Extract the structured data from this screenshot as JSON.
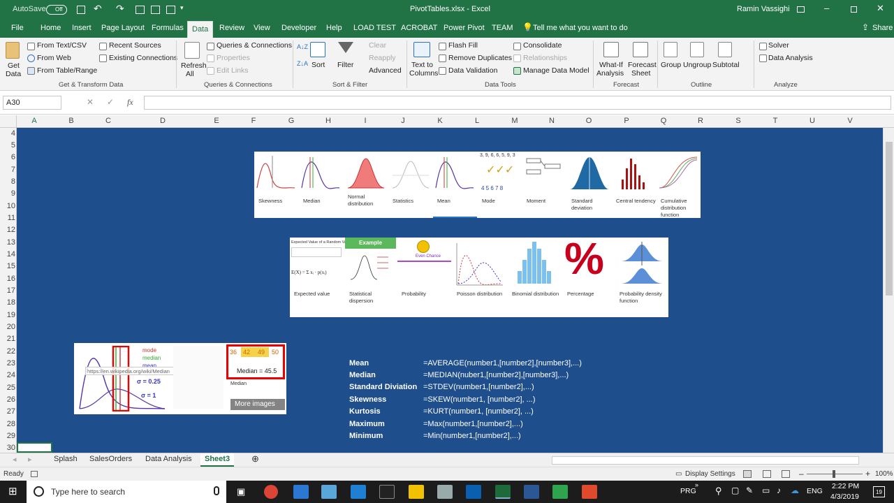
{
  "window": {
    "autosave_label": "AutoSave",
    "autosave_state": "Off",
    "title": "PivotTables.xlsx  -  Excel",
    "user": "Ramin Vassighi"
  },
  "ribbon_tabs": [
    "File",
    "Home",
    "Insert",
    "Page Layout",
    "Formulas",
    "Data",
    "Review",
    "View",
    "Developer",
    "Help",
    "LOAD TEST",
    "ACROBAT",
    "Power Pivot",
    "TEAM"
  ],
  "tell_me": "Tell me what you want to do",
  "share": "Share",
  "ribbon": {
    "get_data": "Get",
    "get_data2": "Data",
    "from_text_csv": "From Text/CSV",
    "from_web": "From Web",
    "from_table_range": "From Table/Range",
    "recent_sources": "Recent Sources",
    "existing_connections": "Existing Connections",
    "group_get_transform": "Get & Transform Data",
    "refresh_all": "Refresh",
    "refresh_all2": "All",
    "queries_connections": "Queries & Connections",
    "properties": "Properties",
    "edit_links": "Edit Links",
    "group_queries": "Queries & Connections",
    "sort": "Sort",
    "filter": "Filter",
    "clear": "Clear",
    "reapply": "Reapply",
    "advanced": "Advanced",
    "group_sort_filter": "Sort & Filter",
    "text_to_columns": "Text to",
    "text_to_columns2": "Columns",
    "flash_fill": "Flash Fill",
    "remove_duplicates": "Remove Duplicates",
    "data_validation": "Data Validation",
    "consolidate": "Consolidate",
    "relationships": "Relationships",
    "manage_data_model": "Manage Data Model",
    "group_data_tools": "Data Tools",
    "what_if": "What-If",
    "what_if2": "Analysis",
    "forecast_sheet": "Forecast",
    "forecast_sheet2": "Sheet",
    "group_forecast": "Forecast",
    "group_btn": "Group",
    "ungroup": "Ungroup",
    "subtotal": "Subtotal",
    "group_outline": "Outline",
    "solver": "Solver",
    "data_analysis": "Data Analysis",
    "group_analyze": "Analyze"
  },
  "formula_bar": {
    "name_box": "A30",
    "fx": "fx",
    "content": ""
  },
  "columns": [
    "A",
    "B",
    "C",
    "D",
    "E",
    "F",
    "G",
    "H",
    "I",
    "J",
    "K",
    "L",
    "M",
    "N",
    "O",
    "P",
    "Q",
    "R",
    "S",
    "T",
    "U",
    "V"
  ],
  "rows": [
    "4",
    "5",
    "6",
    "7",
    "8",
    "9",
    "10",
    "11",
    "12",
    "13",
    "14",
    "15",
    "16",
    "17",
    "18",
    "19",
    "20",
    "21",
    "22",
    "23",
    "24",
    "25",
    "26",
    "27",
    "28",
    "29",
    "30"
  ],
  "gallery1": [
    "Skewness",
    "Median",
    "Normal distribution",
    "Statistics",
    "Mean",
    "Mode",
    "Moment",
    "Standard deviation",
    "Central tendency",
    "Cumulative distribution function"
  ],
  "gallery1_mode_digits": "3, 9, 6, 6, 5, 9, 3",
  "gallery1_mode_row": "4  5  6  7  8",
  "gallery2": [
    "Expected value",
    "Statistical dispersion",
    "Probability",
    "Poisson distribution",
    "Binomial distribution",
    "Percentage",
    "Probability density function"
  ],
  "gallery2_example": "Example",
  "gallery2_percent": "%",
  "gallery2_even_chance": "Even Chance",
  "gallery2_ev_header": "Expected Value of a Random Variable",
  "gallery2_ev_formula": "E(X) = Σ xᵢ · p(xᵢ)",
  "image_thumb": {
    "url": "https://en.wikipedia.org/wiki/Median",
    "median_label": "Median = 45.5",
    "numbers": [
      "36",
      "42",
      "49",
      "50"
    ],
    "more_images": "More images",
    "median_caption": "Median",
    "legend": [
      "mode",
      "median",
      "mean"
    ],
    "sigma1": "σ = 0.25",
    "sigma2": "σ = 1"
  },
  "formulas": [
    {
      "name": "Mean",
      "formula": "=AVERAGE(number1,[number2],[number3],...)"
    },
    {
      "name": "Median",
      "formula": "=MEDIAN(nuber1,[number2],[number3],...)"
    },
    {
      "name": "Standard Diviation",
      "formula": "=STDEV(number1,[number2],...)"
    },
    {
      "name": "Skewness",
      "formula": "=SKEW(number1, [number2], ...)"
    },
    {
      "name": "Kurtosis",
      "formula": "=KURT(number1, [number2], ...)"
    },
    {
      "name": "Maximum",
      "formula": "=Max(number1,[number2],...)"
    },
    {
      "name": "Minimum",
      "formula": "=Min(number1,[number2],...)"
    }
  ],
  "sheet_tabs": [
    "Splash",
    "SalesOrders",
    "Data Analysis",
    "Sheet3"
  ],
  "status": {
    "ready": "Ready",
    "display_settings": "Display Settings",
    "zoom": "100%"
  },
  "taskbar": {
    "search": "Type here to search",
    "lang1": "PRG",
    "lang2": "ENG",
    "time": "2:22 PM",
    "date": "4/3/2019",
    "notif": "19"
  },
  "colors": {
    "excel_green": "#217346",
    "sheet_bg": "#1f4e8c"
  }
}
